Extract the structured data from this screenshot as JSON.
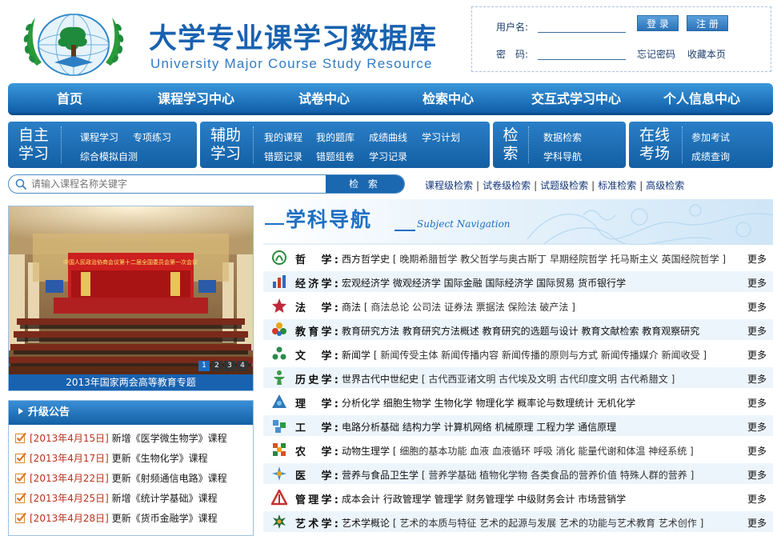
{
  "header": {
    "title": "大学专业课学习数据库",
    "subtitle": "University Major Course Study Resource"
  },
  "login": {
    "username_label": "用户名:",
    "password_label": "密　码:",
    "login_button": "登 录",
    "register_button": "注 册",
    "forgot_link": "忘记密码",
    "bookmark_link": "收藏本页"
  },
  "main_nav": [
    "首页",
    "课程学习中心",
    "试卷中心",
    "检索中心",
    "交互式学习中心",
    "个人信息中心"
  ],
  "sub_nav": [
    {
      "label": "自主学习",
      "links": [
        "课程学习",
        "专项练习",
        "综合模拟自测"
      ]
    },
    {
      "label": "辅助学习",
      "links": [
        "我的课程",
        "我的题库",
        "成绩曲线",
        "学习计划",
        "错题记录",
        "错题组卷",
        "学习记录"
      ]
    },
    {
      "label": "检索",
      "links": [
        "数据检索",
        "学科导航"
      ]
    },
    {
      "label": "在线考场",
      "links": [
        "参加考试",
        "成绩查询"
      ]
    }
  ],
  "search": {
    "placeholder": "请输入课程名称关键字",
    "button": "检 索",
    "links": [
      "课程级检索",
      "试卷级检索",
      "试题级检索",
      "标准检索",
      "高级检索"
    ]
  },
  "banner": {
    "caption": "2013年国家两会高等教育专题",
    "pages": [
      "1",
      "2",
      "3",
      "4"
    ],
    "active_page": "1",
    "screen_text": "中国人民政治协商会议第十二届全国委员会第一次会议"
  },
  "notice": {
    "title": "升级公告",
    "items": [
      {
        "date": "[2013年4月15日]",
        "text": "新增《医学微生物学》课程"
      },
      {
        "date": "[2013年4月17日]",
        "text": "更新《生物化学》课程"
      },
      {
        "date": "[2013年4月22日]",
        "text": "更新《射频通信电路》课程"
      },
      {
        "date": "[2013年4月25日]",
        "text": "新增《统计学基础》课程"
      },
      {
        "date": "[2013年4月28日]",
        "text": "更新《货币金融学》课程"
      }
    ]
  },
  "subject_nav": {
    "title": "学科导航",
    "subtitle": "Subject Navigation",
    "more_label": "更多",
    "rows": [
      {
        "name": "哲　学:",
        "main": "西方哲学史",
        "sub": "[ 晚期希腊哲学 教父哲学与奥古斯丁 早期经院哲学 托马斯主义 英国经院哲学 ]",
        "icon": "philosophy-icon",
        "color": "#2a8a3c"
      },
      {
        "name": "经济学:",
        "main": "宏观经济学 微观经济学 国际金融 国际经济学 国际贸易 货币银行学",
        "sub": "",
        "icon": "economics-icon",
        "color": "#d23a2a"
      },
      {
        "name": "法　学:",
        "main": "商法",
        "sub": "[ 商法总论 公司法 证券法 票据法 保险法 破产法 ]",
        "icon": "law-icon",
        "color": "#c0283a"
      },
      {
        "name": "教育学:",
        "main": "教育研究方法 教育研究方法概述 教育研究的选题与设计 教育文献检索 教育观察研究",
        "sub": "",
        "icon": "education-icon",
        "color": "#e7a51c"
      },
      {
        "name": "文　学:",
        "main": "新闻学",
        "sub": "[ 新闻传受主体 新闻传播内容 新闻传播的原则与方式 新闻传播媒介 新闻收受 ]",
        "icon": "literature-icon",
        "color": "#2b8a4c"
      },
      {
        "name": "历史学:",
        "main": "世界古代中世纪史",
        "sub": "[ 古代西亚诸文明 古代埃及文明 古代印度文明 古代希腊文 ]",
        "icon": "history-icon",
        "color": "#3a9a48"
      },
      {
        "name": "理　学:",
        "main": "分析化学 细胞生物学 生物化学 物理化学 概率论与数理统计 无机化学",
        "sub": "",
        "icon": "science-icon",
        "color": "#2f78b8"
      },
      {
        "name": "工　学:",
        "main": "电路分析基础 结构力学 计算机网络 机械原理 工程力学 通信原理",
        "sub": "",
        "icon": "engineering-icon",
        "color": "#4a8fd0"
      },
      {
        "name": "农　学:",
        "main": "动物生理学",
        "sub": "[ 细胞的基本功能 血液 血液循环 呼吸 消化 能量代谢和体温 神经系统 ]",
        "icon": "agriculture-icon",
        "color": "#d2542a"
      },
      {
        "name": "医　学:",
        "main": "营养与食品卫生学",
        "sub": "[ 营养学基础 植物化学物 各类食品的营养价值 特殊人群的营养 ]",
        "icon": "medicine-icon",
        "color": "#3a8fd0"
      },
      {
        "name": "管理学:",
        "main": "成本会计 行政管理学 管理学 财务管理学 中级财务会计 市场营销学",
        "sub": "",
        "icon": "management-icon",
        "color": "#c63030"
      },
      {
        "name": "艺术学:",
        "main": "艺术学概论",
        "sub": "[ 艺术的本质与特征 艺术的起源与发展 艺术的功能与艺术教育 艺术创作 ]",
        "icon": "art-icon",
        "color": "#1f6a3a"
      }
    ]
  }
}
